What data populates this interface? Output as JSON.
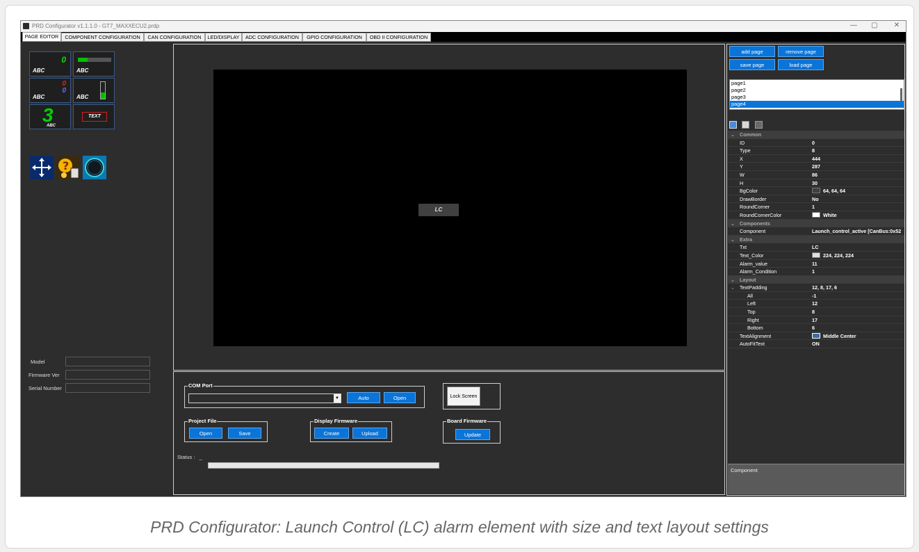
{
  "window": {
    "title": "PRD Configurator v1.1.1.0 - GT7_MAXXECU2.prdp",
    "minimize": "—",
    "maximize": "▢",
    "close": "✕"
  },
  "tabs": [
    "PAGE EDITOR",
    "COMPONENT CONFIGURATION",
    "CAN CONFIGURATION",
    "LED/DISPLAY",
    "ADC CONFIGURATION",
    "GPIO CONFIGURATION",
    "OBD II CONFIGURATION"
  ],
  "widget_palette": {
    "abc": "ABC",
    "digit0": "0",
    "big3": "3",
    "text_widget": "TEXT"
  },
  "device_info": {
    "model_label": "Model",
    "firmware_label": "Firmware Ver",
    "serial_label": "Serial Number"
  },
  "canvas": {
    "element_text": "LC"
  },
  "com_port": {
    "label": "COM Port",
    "auto": "Auto",
    "open": "Open",
    "lock": "Lock Screen"
  },
  "project_file": {
    "label": "Project File",
    "open": "Open",
    "save": "Save"
  },
  "display_firmware": {
    "label": "Display Firmware",
    "create": "Create",
    "upload": "Upload"
  },
  "board_firmware": {
    "label": "Board Firmware",
    "update": "Update"
  },
  "status": {
    "label": "Status :",
    "value": "_"
  },
  "pages": {
    "add": "add page",
    "remove": "remove page",
    "save": "save page",
    "load": "load page",
    "list": [
      "page1",
      "page2",
      "page3",
      "page4"
    ],
    "selected": "page4"
  },
  "properties": {
    "common": {
      "label": "Common",
      "rows": [
        {
          "name": "ID",
          "value": "0"
        },
        {
          "name": "Type",
          "value": "8"
        },
        {
          "name": "X",
          "value": "444"
        },
        {
          "name": "Y",
          "value": "287"
        },
        {
          "name": "W",
          "value": "86"
        },
        {
          "name": "H",
          "value": "30"
        },
        {
          "name": "BgColor",
          "value": "64, 64, 64",
          "swatch": "#404040"
        },
        {
          "name": "DrawBorder",
          "value": "No"
        },
        {
          "name": "RoundCorner",
          "value": "1"
        },
        {
          "name": "RoundCornerColor",
          "value": "White",
          "swatch": "#ffffff"
        }
      ]
    },
    "components": {
      "label": "Components",
      "rows": [
        {
          "name": "Component",
          "value": "Launch_control_active [CanBus:0x52"
        }
      ]
    },
    "extra": {
      "label": "Extra",
      "rows": [
        {
          "name": "Txt",
          "value": "LC"
        },
        {
          "name": "Text_Color",
          "value": "224, 224, 224",
          "swatch": "#e0e0e0"
        },
        {
          "name": "Alarm_value",
          "value": "11"
        },
        {
          "name": "Alarm_Condition",
          "value": "1"
        }
      ]
    },
    "layout": {
      "label": "Layout",
      "text_padding": {
        "name": "TextPadding",
        "value": "12, 8, 17, 6"
      },
      "padding_rows": [
        {
          "name": "All",
          "value": "-1"
        },
        {
          "name": "Left",
          "value": "12"
        },
        {
          "name": "Top",
          "value": "8"
        },
        {
          "name": "Right",
          "value": "17"
        },
        {
          "name": "Bottom",
          "value": "6"
        }
      ],
      "rows": [
        {
          "name": "TextAlignment",
          "value": "Middle Center",
          "swatch": "#3a6ea5"
        },
        {
          "name": "AutoFitText",
          "value": "ON"
        }
      ]
    },
    "description": "Component"
  },
  "caption": "PRD Configurator: Launch Control (LC) alarm element with size and text layout settings",
  "colors": {
    "accent": "#0a74d8",
    "panel": "#2d2d2d",
    "green": "#00c000"
  }
}
